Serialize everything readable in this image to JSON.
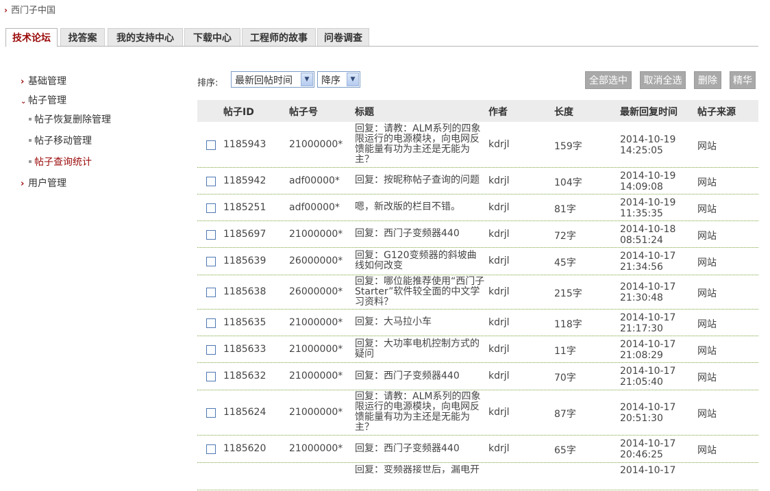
{
  "breadcrumb": {
    "label": "西门子中国"
  },
  "tabs": [
    "技术论坛",
    "找答案",
    "我的支持中心",
    "下载中心",
    "工程师的故事",
    "问卷调查"
  ],
  "sidebar": {
    "basic": "基础管理",
    "posts": "帖子管理",
    "sub_items": [
      "帖子恢复删除管理",
      "帖子移动管理",
      "帖子查询统计"
    ],
    "users": "用户管理"
  },
  "toolbar": {
    "sort_label": "排序:",
    "sort_field": "最新回帖时间",
    "sort_order": "降序",
    "buttons": [
      "全部选中",
      "取消全选",
      "删除",
      "精华"
    ]
  },
  "table": {
    "columns": [
      "帖子ID",
      "帖子号",
      "标题",
      "作者",
      "长度",
      "最新回复时间",
      "帖子来源"
    ],
    "rows": [
      {
        "id": "1185943",
        "num": "21000000*",
        "title": "回复：请教：ALM系列的四象限运行的电源模块，向电网反馈能量有功为主还是无能为主？",
        "author": "kdrjl",
        "length": "159字",
        "date": "2014-10-19",
        "time": "14:25:05",
        "source": "网站"
      },
      {
        "id": "1185942",
        "num": "adf00000*",
        "title": "回复：按昵称帖子查询的问题",
        "author": "kdrjl",
        "length": "104字",
        "date": "2014-10-19",
        "time": "14:09:08",
        "source": "网站"
      },
      {
        "id": "1185251",
        "num": "adf00000*",
        "title": "嗯，新改版的栏目不错。",
        "author": "kdrjl",
        "length": "81字",
        "date": "2014-10-19",
        "time": "11:35:35",
        "source": "网站"
      },
      {
        "id": "1185697",
        "num": "21000000*",
        "title": "回复：西门子变频器440",
        "author": "kdrjl",
        "length": "72字",
        "date": "2014-10-18",
        "time": "08:51:24",
        "source": "网站"
      },
      {
        "id": "1185639",
        "num": "26000000*",
        "title": "回复：G120变频器的斜坡曲线如何改变",
        "author": "kdrjl",
        "length": "45字",
        "date": "2014-10-17",
        "time": "21:34:56",
        "source": "网站"
      },
      {
        "id": "1185638",
        "num": "26000000*",
        "title": "回复：哪位能推荐使用“西门子Starter”软件较全面的中文学习资料？",
        "author": "kdrjl",
        "length": "215字",
        "date": "2014-10-17",
        "time": "21:30:48",
        "source": "网站"
      },
      {
        "id": "1185635",
        "num": "21000000*",
        "title": "回复：大马拉小车",
        "author": "kdrjl",
        "length": "118字",
        "date": "2014-10-17",
        "time": "21:17:30",
        "source": "网站"
      },
      {
        "id": "1185633",
        "num": "21000000*",
        "title": "回复：大功率电机控制方式的疑问",
        "author": "kdrjl",
        "length": "11字",
        "date": "2014-10-17",
        "time": "21:08:29",
        "source": "网站"
      },
      {
        "id": "1185632",
        "num": "21000000*",
        "title": "回复：西门子变频器440",
        "author": "kdrjl",
        "length": "70字",
        "date": "2014-10-17",
        "time": "21:05:40",
        "source": "网站"
      },
      {
        "id": "1185624",
        "num": "21000000*",
        "title": "回复：请教：ALM系列的四象限运行的电源模块，向电网反馈能量有功为主还是无能为主？",
        "author": "kdrjl",
        "length": "87字",
        "date": "2014-10-17",
        "time": "20:51:30",
        "source": "网站"
      },
      {
        "id": "1185620",
        "num": "21000000*",
        "title": "回复：西门子变频器440",
        "author": "kdrjl",
        "length": "65字",
        "date": "2014-10-17",
        "time": "20:46:25",
        "source": "网站"
      },
      {
        "id": "",
        "num": "",
        "title": "回复：变频器接世后，漏电开",
        "author": "",
        "length": "",
        "date": "2014-10-17",
        "time": "",
        "source": ""
      }
    ]
  }
}
